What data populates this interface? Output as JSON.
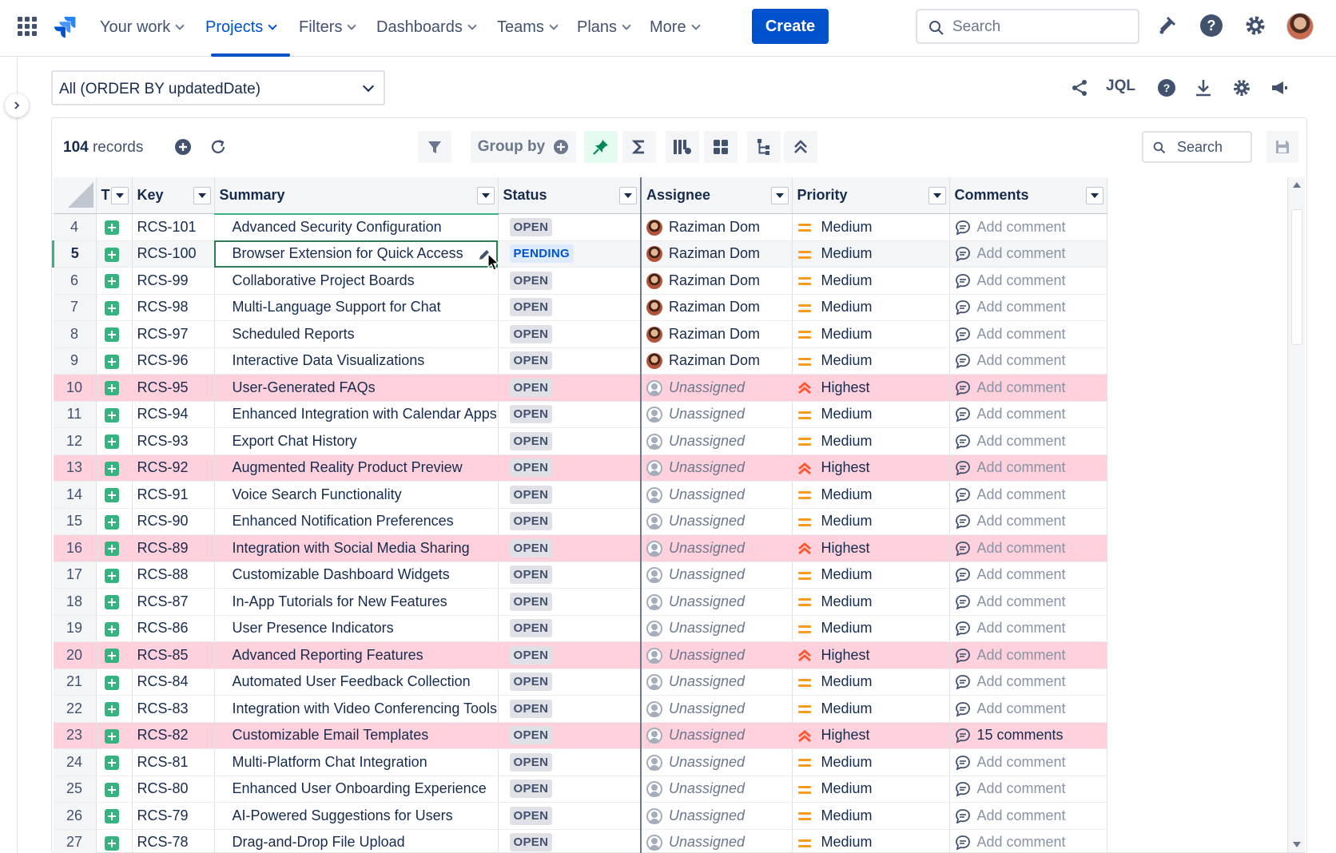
{
  "nav": {
    "items": [
      {
        "label": "Your work",
        "name": "nav-your-work"
      },
      {
        "label": "Projects",
        "name": "nav-projects",
        "active": true
      },
      {
        "label": "Filters",
        "name": "nav-filters"
      },
      {
        "label": "Dashboards",
        "name": "nav-dashboards"
      },
      {
        "label": "Teams",
        "name": "nav-teams"
      },
      {
        "label": "Plans",
        "name": "nav-plans"
      },
      {
        "label": "More",
        "name": "nav-more"
      }
    ],
    "create_label": "Create",
    "search_placeholder": "Search",
    "accent": "#0052cc"
  },
  "filter": {
    "selected": "All (ORDER BY updatedDate)",
    "jql_label": "JQL"
  },
  "grid": {
    "record_count": "104",
    "records_label": "records",
    "group_by_label": "Group by",
    "search_placeholder": "Search",
    "columns": [
      "T",
      "Key",
      "Summary",
      "Status",
      "Assignee",
      "Priority",
      "Comments"
    ],
    "rows": [
      {
        "num": "4",
        "key": "RCS-101",
        "summary": "Advanced Security Configuration",
        "status": "OPEN",
        "assignee": "Raziman Dom",
        "priority": "Medium",
        "comments": "Add comment"
      },
      {
        "num": "5",
        "key": "RCS-100",
        "summary": "Browser Extension for Quick Access",
        "status": "PENDING",
        "assignee": "Raziman Dom",
        "priority": "Medium",
        "comments": "Add comment",
        "selected": true
      },
      {
        "num": "6",
        "key": "RCS-99",
        "summary": "Collaborative Project Boards",
        "status": "OPEN",
        "assignee": "Raziman Dom",
        "priority": "Medium",
        "comments": "Add comment"
      },
      {
        "num": "7",
        "key": "RCS-98",
        "summary": "Multi-Language Support for Chat",
        "status": "OPEN",
        "assignee": "Raziman Dom",
        "priority": "Medium",
        "comments": "Add comment"
      },
      {
        "num": "8",
        "key": "RCS-97",
        "summary": "Scheduled Reports",
        "status": "OPEN",
        "assignee": "Raziman Dom",
        "priority": "Medium",
        "comments": "Add comment"
      },
      {
        "num": "9",
        "key": "RCS-96",
        "summary": "Interactive Data Visualizations",
        "status": "OPEN",
        "assignee": "Raziman Dom",
        "priority": "Medium",
        "comments": "Add comment"
      },
      {
        "num": "10",
        "key": "RCS-95",
        "summary": "User-Generated FAQs",
        "status": "OPEN",
        "assignee": "Unassigned",
        "priority": "Highest",
        "comments": "Add comment"
      },
      {
        "num": "11",
        "key": "RCS-94",
        "summary": "Enhanced Integration with Calendar Apps",
        "status": "OPEN",
        "assignee": "Unassigned",
        "priority": "Medium",
        "comments": "Add comment"
      },
      {
        "num": "12",
        "key": "RCS-93",
        "summary": "Export Chat History",
        "status": "OPEN",
        "assignee": "Unassigned",
        "priority": "Medium",
        "comments": "Add comment"
      },
      {
        "num": "13",
        "key": "RCS-92",
        "summary": "Augmented Reality Product Preview",
        "status": "OPEN",
        "assignee": "Unassigned",
        "priority": "Highest",
        "comments": "Add comment"
      },
      {
        "num": "14",
        "key": "RCS-91",
        "summary": "Voice Search Functionality",
        "status": "OPEN",
        "assignee": "Unassigned",
        "priority": "Medium",
        "comments": "Add comment"
      },
      {
        "num": "15",
        "key": "RCS-90",
        "summary": "Enhanced Notification Preferences",
        "status": "OPEN",
        "assignee": "Unassigned",
        "priority": "Medium",
        "comments": "Add comment"
      },
      {
        "num": "16",
        "key": "RCS-89",
        "summary": "Integration with Social Media Sharing",
        "status": "OPEN",
        "assignee": "Unassigned",
        "priority": "Highest",
        "comments": "Add comment"
      },
      {
        "num": "17",
        "key": "RCS-88",
        "summary": "Customizable Dashboard Widgets",
        "status": "OPEN",
        "assignee": "Unassigned",
        "priority": "Medium",
        "comments": "Add comment"
      },
      {
        "num": "18",
        "key": "RCS-87",
        "summary": "In-App Tutorials for New Features",
        "status": "OPEN",
        "assignee": "Unassigned",
        "priority": "Medium",
        "comments": "Add comment"
      },
      {
        "num": "19",
        "key": "RCS-86",
        "summary": "User Presence Indicators",
        "status": "OPEN",
        "assignee": "Unassigned",
        "priority": "Medium",
        "comments": "Add comment"
      },
      {
        "num": "20",
        "key": "RCS-85",
        "summary": "Advanced Reporting Features",
        "status": "OPEN",
        "assignee": "Unassigned",
        "priority": "Highest",
        "comments": "Add comment"
      },
      {
        "num": "21",
        "key": "RCS-84",
        "summary": "Automated User Feedback Collection",
        "status": "OPEN",
        "assignee": "Unassigned",
        "priority": "Medium",
        "comments": "Add comment"
      },
      {
        "num": "22",
        "key": "RCS-83",
        "summary": "Integration with Video Conferencing Tools",
        "status": "OPEN",
        "assignee": "Unassigned",
        "priority": "Medium",
        "comments": "Add comment"
      },
      {
        "num": "23",
        "key": "RCS-82",
        "summary": "Customizable Email Templates",
        "status": "OPEN",
        "assignee": "Unassigned",
        "priority": "Highest",
        "comments": "15 comments"
      },
      {
        "num": "24",
        "key": "RCS-81",
        "summary": "Multi-Platform Chat Integration",
        "status": "OPEN",
        "assignee": "Unassigned",
        "priority": "Medium",
        "comments": "Add comment"
      },
      {
        "num": "25",
        "key": "RCS-80",
        "summary": "Enhanced User Onboarding Experience",
        "status": "OPEN",
        "assignee": "Unassigned",
        "priority": "Medium",
        "comments": "Add comment"
      },
      {
        "num": "26",
        "key": "RCS-79",
        "summary": "AI-Powered Suggestions for Users",
        "status": "OPEN",
        "assignee": "Unassigned",
        "priority": "Medium",
        "comments": "Add comment"
      },
      {
        "num": "27",
        "key": "RCS-78",
        "summary": "Drag-and-Drop File Upload",
        "status": "OPEN",
        "assignee": "Unassigned",
        "priority": "Medium",
        "comments": "Add comment"
      }
    ],
    "colors": {
      "highlight_row": "#ffd1dc",
      "story_type": "#36b37e",
      "medium_priority": "#ff991f",
      "highest_priority": "#ff5630",
      "selection": "#2e7d52"
    }
  }
}
